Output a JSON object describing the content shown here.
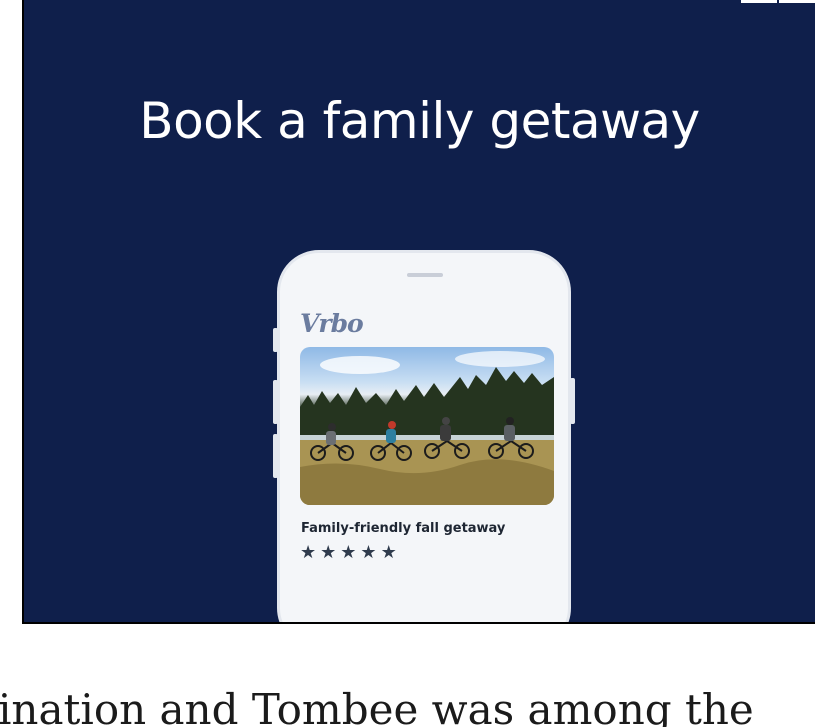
{
  "ad": {
    "headline": "Book a family getaway",
    "background_color": "#0f1f4b",
    "phone": {
      "logo": "Vrbo",
      "photo_icon": "family-biking-photo",
      "card_title": "Family-friendly fall getaway",
      "rating": 5,
      "stars": [
        "★",
        "★",
        "★",
        "★",
        "★"
      ]
    }
  },
  "article": {
    "text_fragment": "ination and Tombee was among the"
  }
}
